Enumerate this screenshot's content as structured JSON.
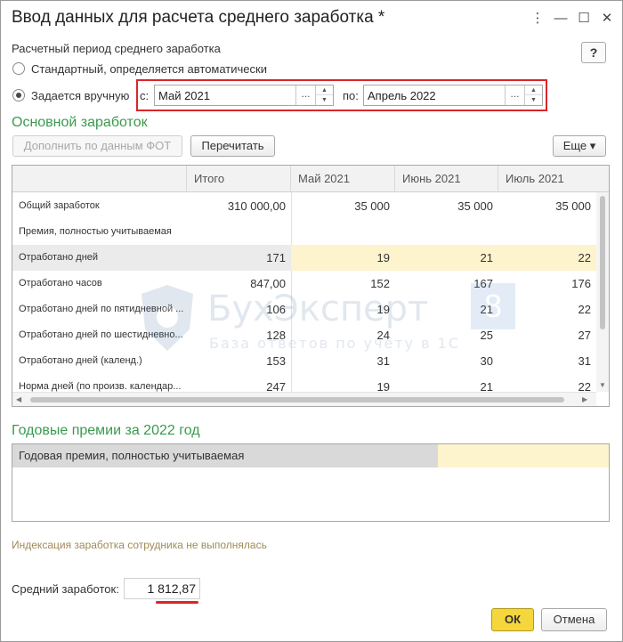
{
  "window": {
    "title": "Ввод данных для расчета среднего заработка *",
    "controls": {
      "menu": "⋮",
      "minimize": "—",
      "maximize": "☐",
      "close": "✕"
    },
    "help_label": "?"
  },
  "period": {
    "group_label": "Расчетный период среднего заработка",
    "option_auto": "Стандартный, определяется автоматически",
    "option_manual": "Задается вручную",
    "selected": "manual",
    "from_label": "с:",
    "from_value": "Май 2021",
    "to_label": "по:",
    "to_value": "Апрель 2022",
    "select_glyph": "...",
    "spin_up": "▲",
    "spin_down": "▼"
  },
  "main_earnings": {
    "title": "Основной заработок",
    "fill_button": "Дополнить по данным ФОТ",
    "recalc_button": "Перечитать",
    "more_button": "Еще ▾",
    "columns": [
      "",
      "Итого",
      "Май 2021",
      "Июнь 2021",
      "Июль 2021"
    ],
    "rows": [
      {
        "name": "Общий заработок",
        "total": "310 000,00",
        "m1": "35 000",
        "m2": "35 000",
        "m3": "35 000"
      },
      {
        "name": "Премия, полностью учитываемая",
        "total": "",
        "m1": "",
        "m2": "",
        "m3": ""
      },
      {
        "name": "Отработано дней",
        "total": "171",
        "m1": "19",
        "m2": "21",
        "m3": "22"
      },
      {
        "name": "Отработано часов",
        "total": "847,00",
        "m1": "152",
        "m2": "167",
        "m3": "176"
      },
      {
        "name": "Отработано дней по пятидневной ...",
        "total": "106",
        "m1": "19",
        "m2": "21",
        "m3": "22"
      },
      {
        "name": "Отработано дней по шестидневно...",
        "total": "128",
        "m1": "24",
        "m2": "25",
        "m3": "27"
      },
      {
        "name": "Отработано дней (календ.)",
        "total": "153",
        "m1": "31",
        "m2": "30",
        "m3": "31"
      },
      {
        "name": "Норма дней (по произв. календар...",
        "total": "247",
        "m1": "19",
        "m2": "21",
        "m3": "22"
      }
    ],
    "highlight_row_index": 2
  },
  "watermark": {
    "text": "БухЭксперт",
    "badge": "8",
    "subtitle": "База ответов по учёту в 1С"
  },
  "bonuses": {
    "title": "Годовые премии за 2022 год",
    "rows": [
      {
        "name": "Годовая премия, полностью учитываемая",
        "value": ""
      }
    ]
  },
  "indexation_note": "Индексация заработка сотрудника не выполнялась",
  "average": {
    "label": "Средний заработок:",
    "value": "1 812,87"
  },
  "footer": {
    "ok_label": "ОК",
    "cancel_label": "Отмена"
  },
  "colors": {
    "accent_green": "#3a9a4e",
    "highlight_red": "#d9252a",
    "ok_yellow": "#f5d63c",
    "cell_yellow": "#fdf3cd"
  }
}
